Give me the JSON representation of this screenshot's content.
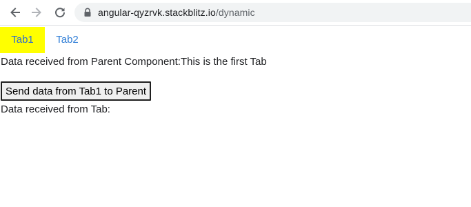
{
  "browser": {
    "url_host": "angular-qyzrvk.stackblitz.io",
    "url_path": "/dynamic",
    "back_icon": "arrow-left-icon",
    "forward_icon": "arrow-right-icon",
    "reload_icon": "reload-icon",
    "lock_icon": "lock-icon"
  },
  "tabs": [
    {
      "label": "Tab1",
      "active": true
    },
    {
      "label": "Tab2",
      "active": false
    }
  ],
  "content": {
    "parent_data_text": "Data received from Parent Component:This is the first Tab",
    "send_button_label": "Send data from Tab1 to Parent",
    "tab_data_text": "Data received from Tab:"
  },
  "colors": {
    "active_tab_bg": "#ffff00",
    "tab_text": "#2e7dd6"
  }
}
